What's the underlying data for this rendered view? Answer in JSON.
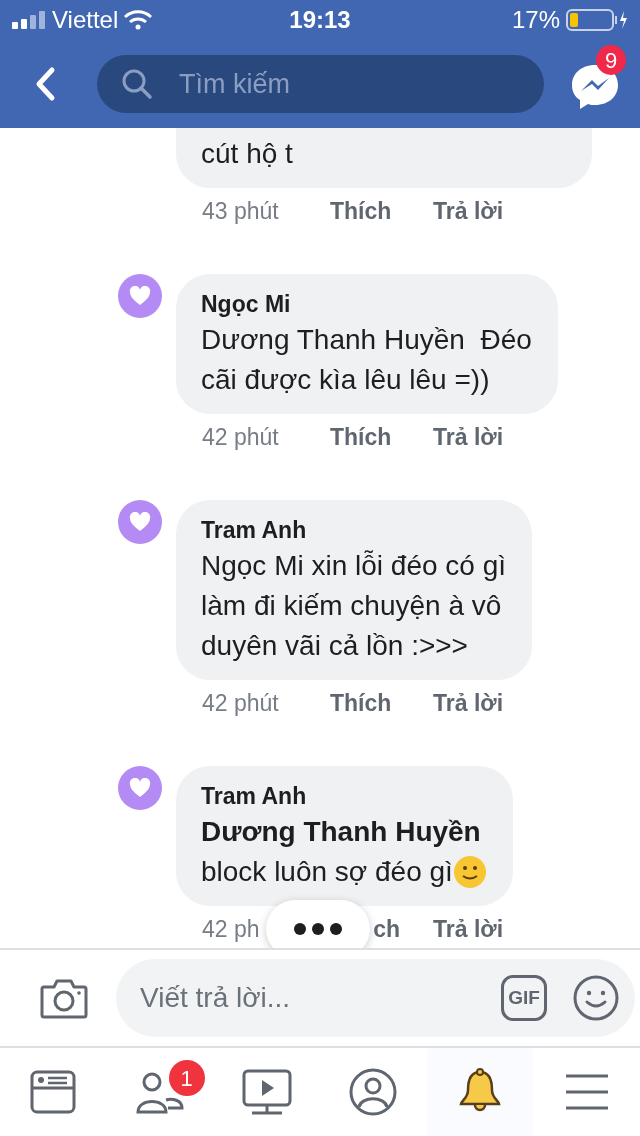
{
  "status_bar": {
    "carrier": "Viettel",
    "time": "19:13",
    "battery": "17%"
  },
  "header": {
    "search": {
      "placeholder": "Tìm kiếm"
    },
    "messenger_badge": "9"
  },
  "comments": [
    {
      "kind": "cut",
      "lines": [
        "cút hộ t"
      ],
      "meta": {
        "time": "43 phút",
        "like": "Thích",
        "reply": "Trả lời"
      }
    },
    {
      "kind": "full",
      "author": "Ngọc Mi",
      "lines": [
        "Dương Thanh Huyền  Đéo",
        "cãi được kìa lêu lêu =))"
      ],
      "meta": {
        "time": "42 phút",
        "like": "Thích",
        "reply": "Trả lời"
      }
    },
    {
      "kind": "full",
      "author": "Tram Anh",
      "lines": [
        "Ngọc Mi xin lỗi đéo có gì",
        "làm đi kiếm chuyện à vô",
        "duyên vãi cả lồn :>>>"
      ],
      "meta": {
        "time": "42 phút",
        "like": "Thích",
        "reply": "Trả lời"
      }
    },
    {
      "kind": "full",
      "author": "Tram Anh",
      "mention": "Dương Thanh Huyền",
      "lines": [
        "block luôn sợ đéo gì"
      ],
      "emoji": true,
      "covered": true,
      "meta": {
        "time": "42 ph",
        "like": "ch",
        "reply": "Trả lời"
      }
    }
  ],
  "composer": {
    "placeholder": "Viết trả lời...",
    "gif": "GIF"
  },
  "tab_bar": {
    "tabs": [
      {
        "kind": "news",
        "selected": false
      },
      {
        "kind": "friends",
        "selected": false,
        "badge": "1"
      },
      {
        "kind": "video",
        "selected": false
      },
      {
        "kind": "profile",
        "selected": false
      },
      {
        "kind": "notifications",
        "selected": true
      },
      {
        "kind": "menu",
        "selected": false
      }
    ]
  }
}
